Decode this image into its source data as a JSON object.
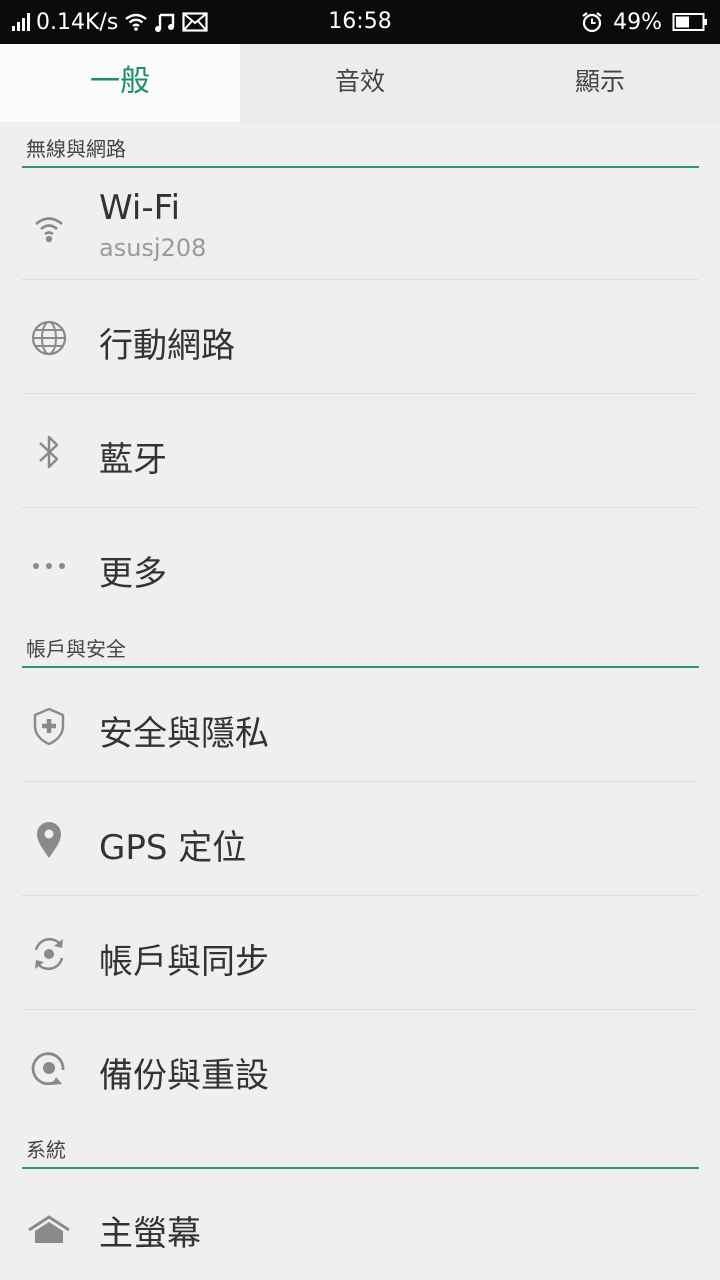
{
  "status_bar": {
    "speed": "0.14K/s",
    "time": "16:58",
    "battery": "49%",
    "icons": [
      "signal-icon",
      "wifi-icon",
      "music-icon",
      "mail-icon",
      "alarm-icon",
      "battery-icon"
    ]
  },
  "tabs": [
    {
      "label": "一般",
      "active": true
    },
    {
      "label": "音效",
      "active": false
    },
    {
      "label": "顯示",
      "active": false
    }
  ],
  "sections": {
    "wireless": "無線與網路",
    "account": "帳戶與安全",
    "system": "系統"
  },
  "items": {
    "wifi": {
      "label": "Wi-Fi",
      "sub": "asusj208",
      "icon": "wifi-icon"
    },
    "mobile": {
      "label": "行動網路",
      "icon": "globe-icon"
    },
    "bluetooth": {
      "label": "藍牙",
      "icon": "bluetooth-icon"
    },
    "more": {
      "label": "更多",
      "icon": "more-icon"
    },
    "security": {
      "label": "安全與隱私",
      "icon": "shield-icon"
    },
    "gps": {
      "label": "GPS 定位",
      "icon": "location-pin-icon"
    },
    "sync": {
      "label": "帳戶與同步",
      "icon": "sync-icon"
    },
    "backup": {
      "label": "備份與重設",
      "icon": "backup-icon"
    },
    "home": {
      "label": "主螢幕",
      "icon": "home-icon"
    }
  },
  "colors": {
    "accent": "#1e8f64",
    "divider": "#2f9a70",
    "icon": "#8a8a8a"
  }
}
